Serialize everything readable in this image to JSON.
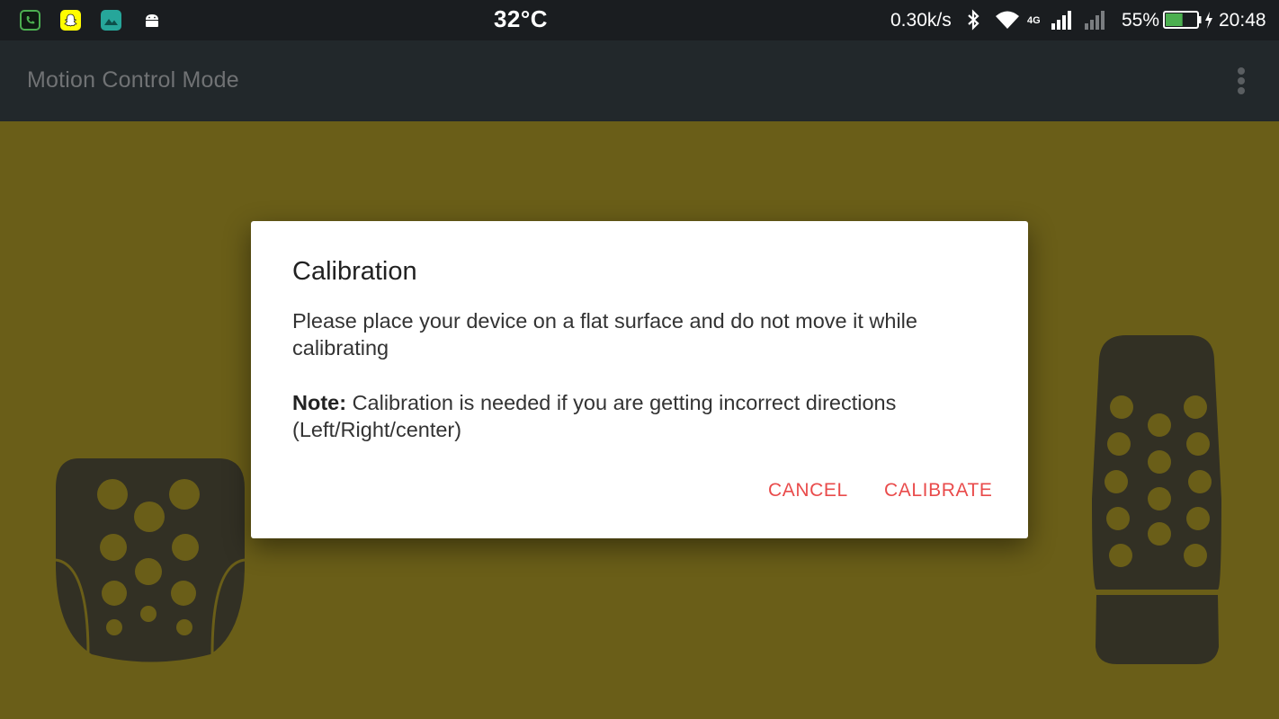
{
  "status_bar": {
    "temperature": "32°C",
    "net_speed": "0.30k/s",
    "network_type": "4G",
    "battery_percent": "55%",
    "battery_level": 0.55,
    "battery_color": "#4caf50",
    "time": "20:48",
    "notification_icons": [
      "whatsapp-icon",
      "snapchat-icon",
      "gallery-icon",
      "android-icon"
    ]
  },
  "app_bar": {
    "title": "Motion Control Mode",
    "menu_icon": "overflow-menu-icon"
  },
  "dialog": {
    "title": "Calibration",
    "message": "Please place your device on a flat surface and do not move it while calibrating",
    "note_label": "Note:",
    "note_text": " Calibration is needed if you are getting incorrect directions (Left/Right/center)",
    "buttons": {
      "cancel": "CANCEL",
      "calibrate": "CALIBRATE"
    },
    "button_color": "#e94b4b"
  },
  "colors": {
    "background": "#6a5e18",
    "pedal": "#323024",
    "app_bar": "#22282b",
    "status_bar": "#1a1d20"
  }
}
